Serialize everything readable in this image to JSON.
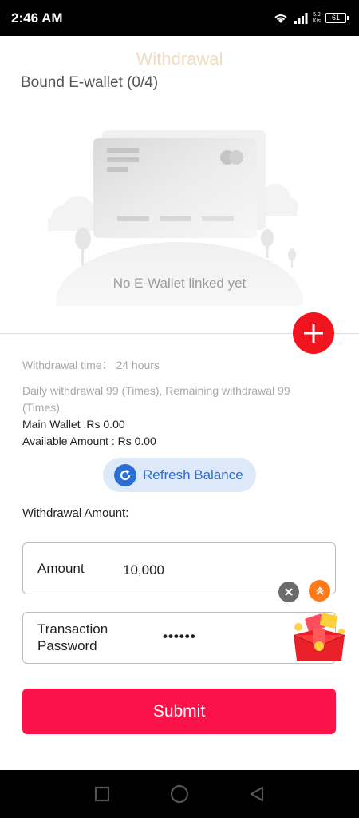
{
  "status_bar": {
    "time": "2:46 AM",
    "net_speed": "5.9",
    "net_unit": "K/s",
    "battery": "61"
  },
  "header": {
    "title": "Withdrawal",
    "bound_wallet": "Bound E-wallet (0/4)"
  },
  "wallet": {
    "empty_text": "No E-Wallet linked yet",
    "add_icon": "plus-icon"
  },
  "info": {
    "withdrawal_time": "Withdrawal time：  24 hours",
    "daily_line1": "Daily withdrawal 99 (Times), Remaining withdrawal 99",
    "daily_line2": "(Times)",
    "main_wallet": "Main Wallet :Rs 0.00",
    "available_amount": "Available Amount : Rs 0.00"
  },
  "refresh": {
    "label": "Refresh Balance",
    "icon": "refresh-icon"
  },
  "form": {
    "section_label": "Withdrawal Amount:",
    "amount_label": "Amount",
    "amount_value": "10,000",
    "password_label_line1": "Transaction",
    "password_label_line2": "Password",
    "password_value": "••••••",
    "submit_label": "Submit"
  },
  "colors": {
    "accent_red": "#fa1248",
    "add_button": "#f0141e",
    "refresh_blue": "#2b6fd6",
    "refresh_bg": "#dde9f9"
  }
}
